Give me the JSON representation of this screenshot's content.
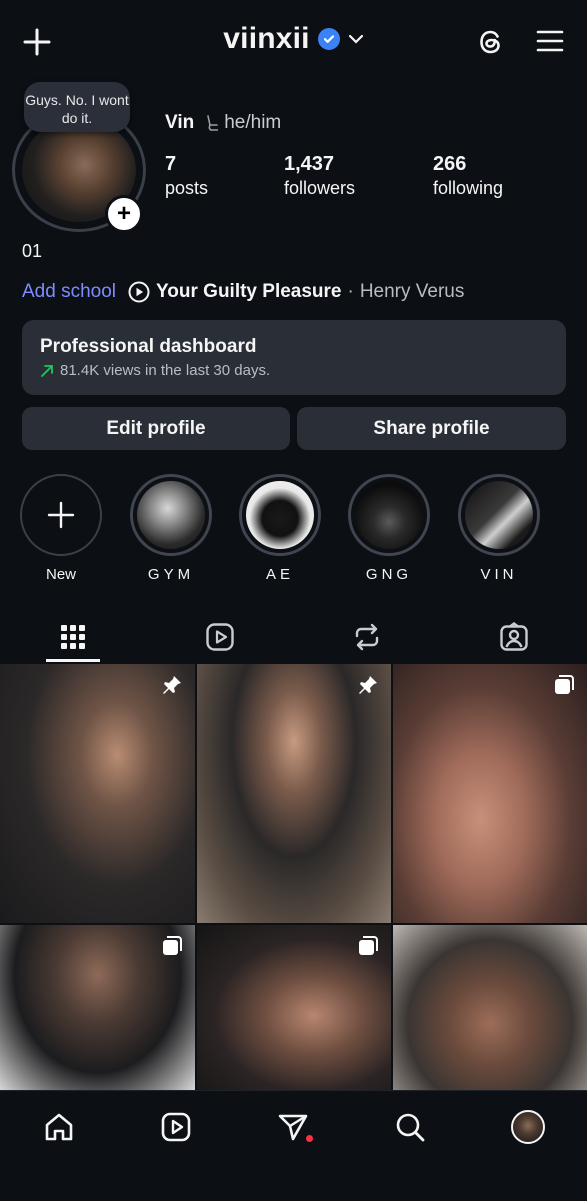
{
  "header": {
    "username": "viinxii",
    "verified": true,
    "accent": "#3b82f6"
  },
  "note": {
    "text": "Guys. No. I wont do it."
  },
  "profile": {
    "name": "Vin",
    "pronouns": "he/him",
    "stats": [
      {
        "value": "7",
        "label": "posts"
      },
      {
        "value": "1,437",
        "label": "followers"
      },
      {
        "value": "266",
        "label": "following"
      }
    ],
    "bio": "01",
    "add_school": "Add school",
    "music": {
      "song": "Your Guilty Pleasure",
      "separator": "·",
      "artist": "Henry Verus"
    }
  },
  "dashboard": {
    "title": "Professional dashboard",
    "subtitle": "81.4K views in the last 30 days.",
    "trend_color": "#22c55e"
  },
  "buttons": {
    "edit": "Edit profile",
    "share": "Share profile"
  },
  "highlights": [
    {
      "label": "New"
    },
    {
      "label": "GYM"
    },
    {
      "label": "AE"
    },
    {
      "label": "GNG"
    },
    {
      "label": "VIN"
    }
  ],
  "tabs": [
    {
      "icon": "grid-icon",
      "active": true
    },
    {
      "icon": "reels-icon",
      "active": false
    },
    {
      "icon": "reposts-icon",
      "active": false
    },
    {
      "icon": "tagged-icon",
      "active": false
    }
  ],
  "posts": [
    {
      "badge": "pin-icon"
    },
    {
      "badge": "pin-icon"
    },
    {
      "badge": "carousel-icon"
    },
    {
      "badge": "carousel-icon"
    },
    {
      "badge": "carousel-icon"
    },
    {
      "badge": ""
    }
  ],
  "bottom_nav": [
    "home-icon",
    "reels-icon",
    "direct-icon",
    "search-icon",
    "profile-avatar"
  ],
  "notification_dot_color": "#ff3040"
}
